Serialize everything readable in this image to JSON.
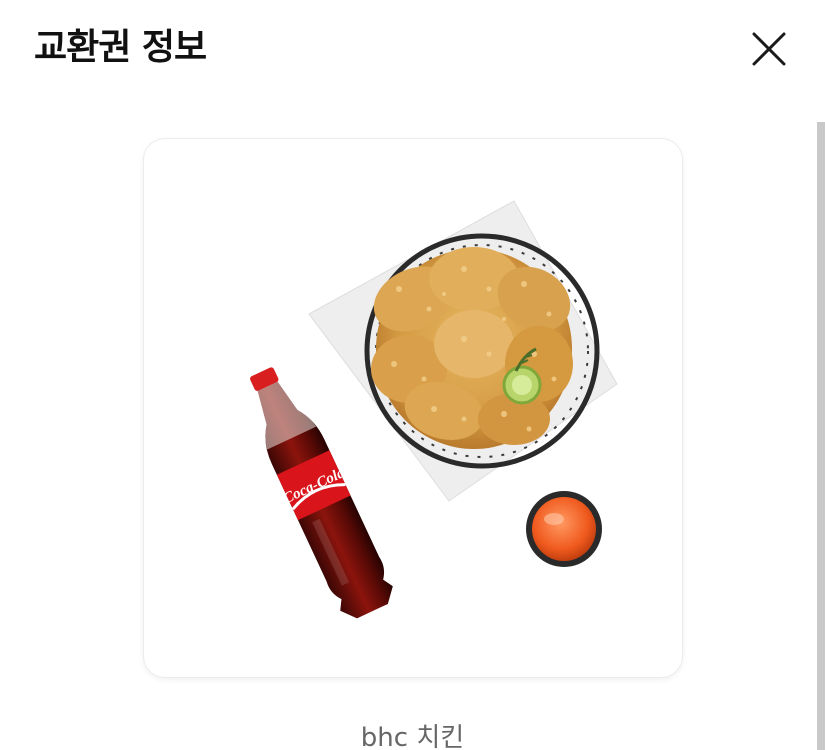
{
  "header": {
    "title": "교환권 정보",
    "close_icon": "close-icon"
  },
  "product": {
    "image_icon": "chicken-cola-set-image",
    "bottle_label": "Coca-Cola",
    "name": "bhc 치킨"
  },
  "colors": {
    "title_text": "#111111",
    "product_name_text": "#666666",
    "scrollbar": "#c9c9c9",
    "card_border": "#ececec"
  }
}
